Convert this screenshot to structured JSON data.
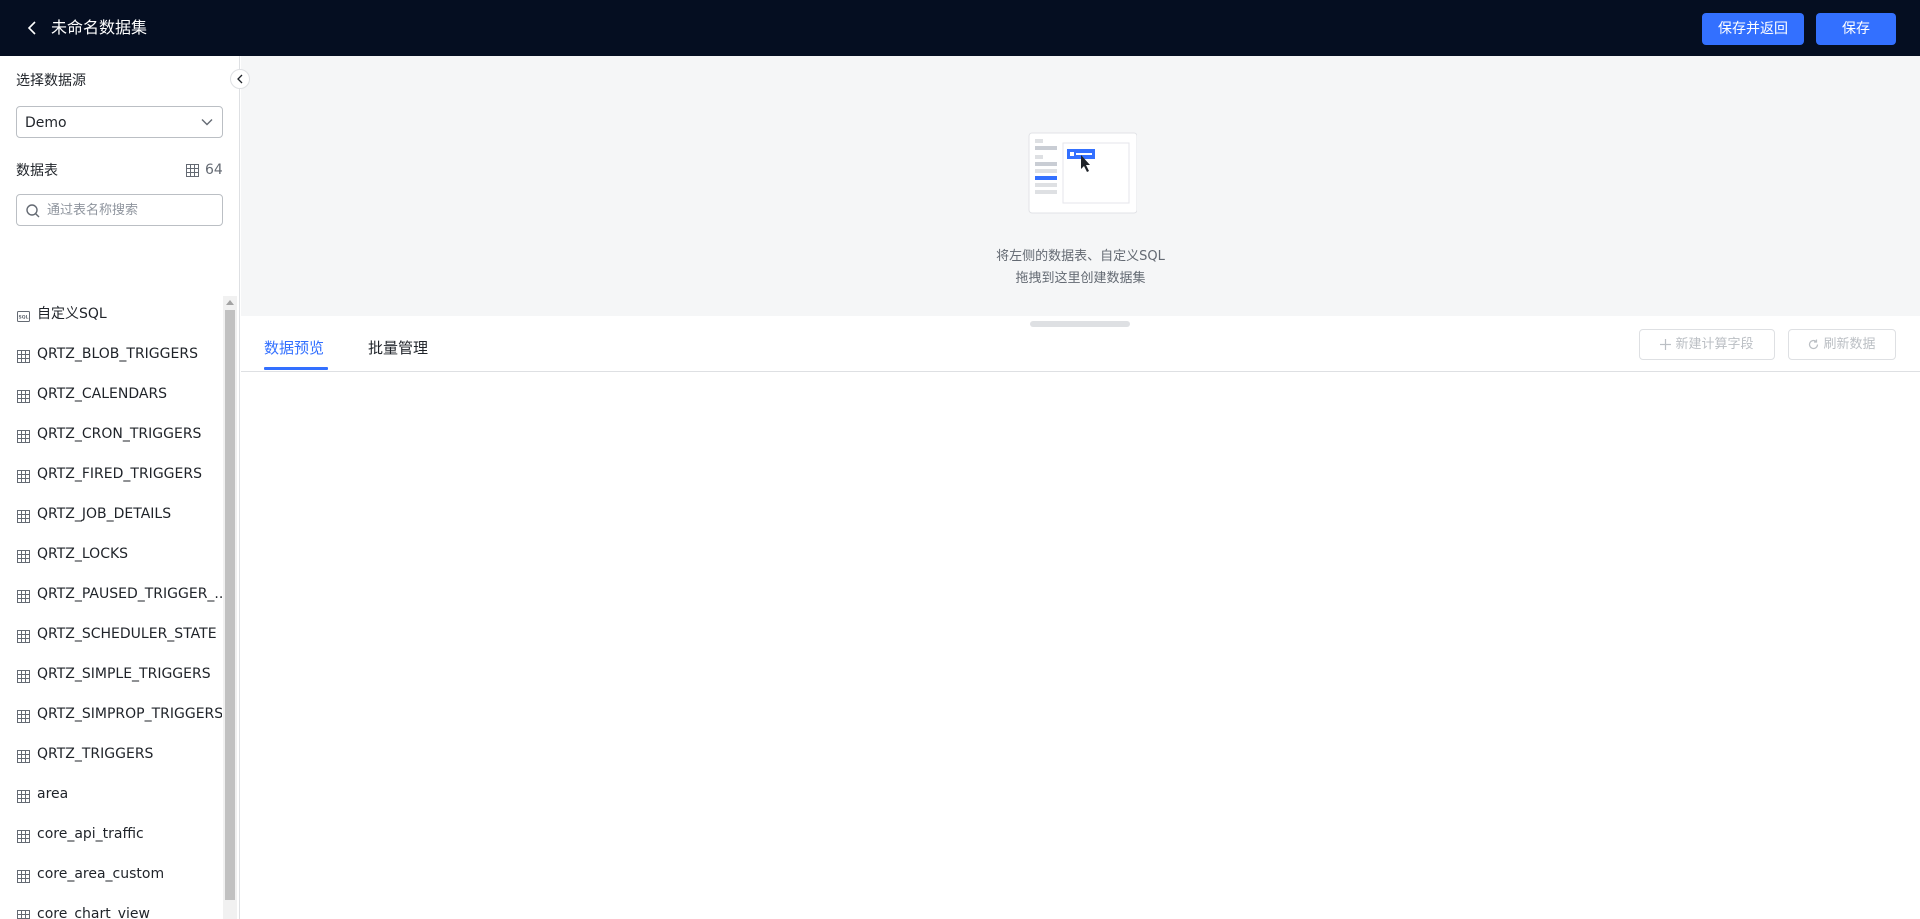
{
  "header": {
    "title": "未命名数据集",
    "save_return_label": "保存并返回",
    "save_label": "保存"
  },
  "sidebar": {
    "datasource_label": "选择数据源",
    "datasource_value": "Demo",
    "tables_label": "数据表",
    "table_count": "64",
    "search_placeholder": "通过表名称搜索",
    "items": [
      {
        "label": "自定义SQL",
        "icon": "sql-icon"
      },
      {
        "label": "QRTZ_BLOB_TRIGGERS",
        "icon": "table-icon"
      },
      {
        "label": "QRTZ_CALENDARS",
        "icon": "table-icon"
      },
      {
        "label": "QRTZ_CRON_TRIGGERS",
        "icon": "table-icon"
      },
      {
        "label": "QRTZ_FIRED_TRIGGERS",
        "icon": "table-icon"
      },
      {
        "label": "QRTZ_JOB_DETAILS",
        "icon": "table-icon"
      },
      {
        "label": "QRTZ_LOCKS",
        "icon": "table-icon"
      },
      {
        "label": "QRTZ_PAUSED_TRIGGER_...",
        "icon": "table-icon"
      },
      {
        "label": "QRTZ_SCHEDULER_STATE",
        "icon": "table-icon"
      },
      {
        "label": "QRTZ_SIMPLE_TRIGGERS",
        "icon": "table-icon"
      },
      {
        "label": "QRTZ_SIMPROP_TRIGGERS",
        "icon": "table-icon"
      },
      {
        "label": "QRTZ_TRIGGERS",
        "icon": "table-icon"
      },
      {
        "label": "area",
        "icon": "table-icon"
      },
      {
        "label": "core_api_traffic",
        "icon": "table-icon"
      },
      {
        "label": "core_area_custom",
        "icon": "table-icon"
      },
      {
        "label": "core_chart_view",
        "icon": "table-icon"
      }
    ]
  },
  "dropzone": {
    "hint_line1": "将左侧的数据表、自定义SQL",
    "hint_line2": "拖拽到这里创建数据集"
  },
  "tabs": {
    "preview": "数据预览",
    "batch": "批量管理"
  },
  "actions": {
    "new_field": "新建计算字段",
    "refresh": "刷新数据"
  },
  "colors": {
    "header_bg": "#050e21",
    "primary": "#3370ff"
  }
}
